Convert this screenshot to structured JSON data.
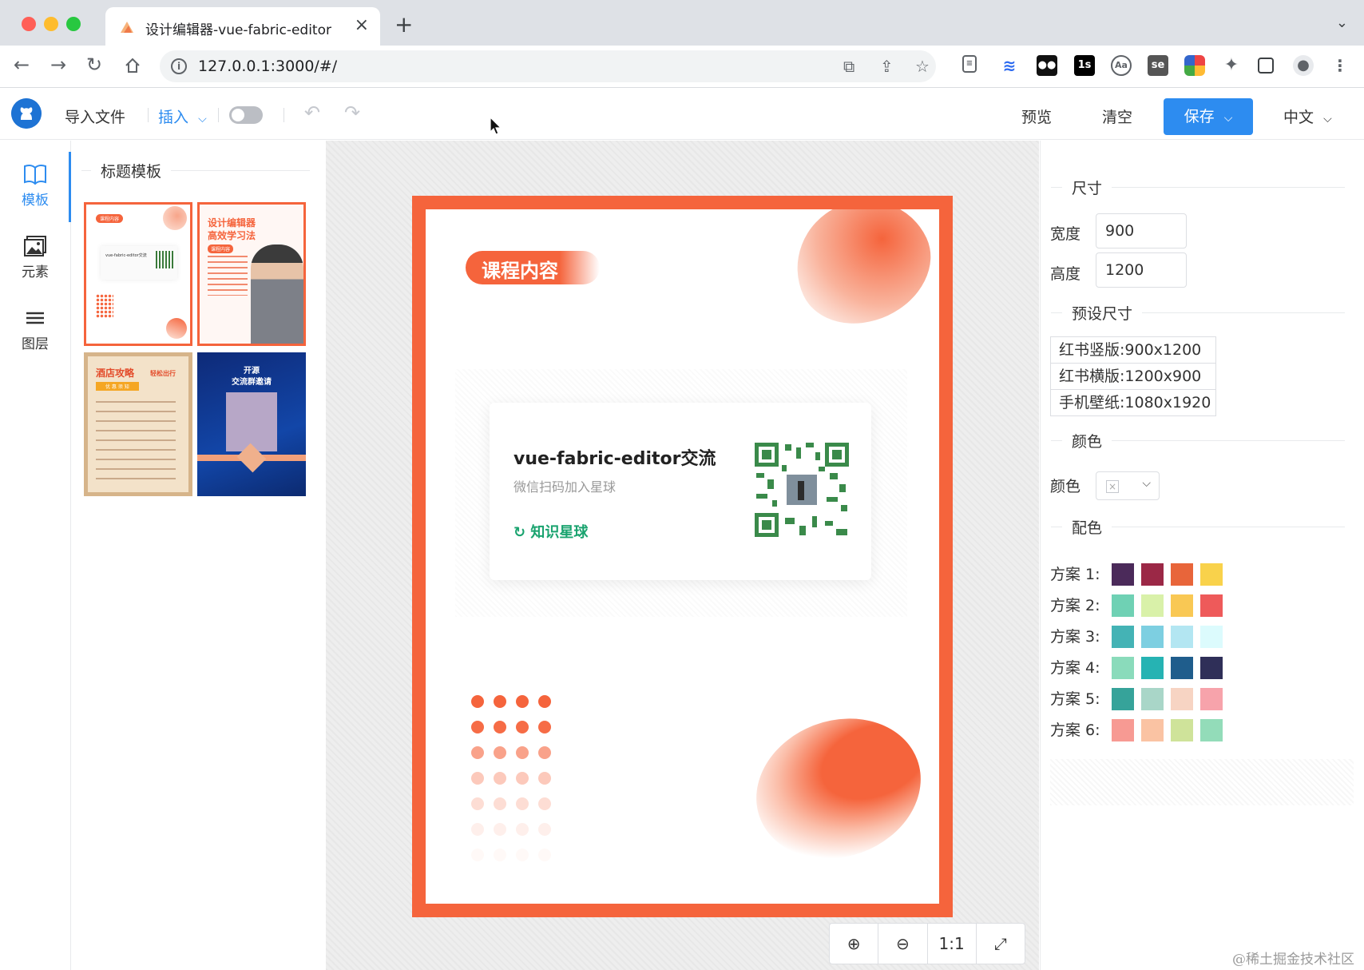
{
  "browser": {
    "tab_title": "设计编辑器-vue-fabric-editor",
    "url": "127.0.0.1:3000/#/",
    "extensions": [
      "1s",
      "se",
      "Aa"
    ]
  },
  "toolbar": {
    "import_label": "导入文件",
    "insert_label": "插入",
    "preview_label": "预览",
    "clear_label": "清空",
    "save_label": "保存",
    "language_label": "中文"
  },
  "rail": {
    "items": [
      {
        "label": "模板",
        "icon": "book-icon",
        "active": true
      },
      {
        "label": "元素",
        "icon": "image-icon",
        "active": false
      },
      {
        "label": "图层",
        "icon": "layers-icon",
        "active": false
      }
    ]
  },
  "templates": {
    "section_title": "标题模板",
    "thumb_texts": {
      "t1_tag": "课程内容",
      "t1_title": "vue-fabric-editor交流",
      "t2_title_1": "设计编辑器",
      "t2_title_2": "高效学习法",
      "t2_tag": "课程内容",
      "t3_title": "酒店攻略",
      "t3_sub": "轻松出行",
      "t3_tag": "优 惠 须 知",
      "t4_title_1": "开源",
      "t4_title_2": "交流群邀请"
    }
  },
  "poster": {
    "tag": "课程内容",
    "card_title": "vue-fabric-editor交流",
    "card_subtitle": "微信扫码加入星球",
    "brand": "知识星球",
    "accent_color": "#f5643c"
  },
  "zoom": {
    "ratio_label": "1:1"
  },
  "properties": {
    "size_title": "尺寸",
    "width_label": "宽度",
    "width_value": "900",
    "height_label": "高度",
    "height_value": "1200",
    "preset_title": "预设尺寸",
    "presets": [
      "红书竖版:900x1200",
      "红书横版:1200x900",
      "手机壁纸:1080x1920"
    ],
    "color_title": "颜色",
    "color_label": "颜色",
    "palette_title": "配色",
    "schemes": [
      {
        "label": "方案 1:",
        "colors": [
          "#4b2a5a",
          "#9b2846",
          "#e8653a",
          "#f9d24b"
        ]
      },
      {
        "label": "方案 2:",
        "colors": [
          "#6fd1b4",
          "#d9f1a9",
          "#f9c854",
          "#ee5a5a"
        ]
      },
      {
        "label": "方案 3:",
        "colors": [
          "#44b3b5",
          "#7dcfe1",
          "#b3e6f2",
          "#dcfbfd"
        ]
      },
      {
        "label": "方案 4:",
        "colors": [
          "#8adbbb",
          "#26b3b3",
          "#1f5d8c",
          "#2f2f58"
        ]
      },
      {
        "label": "方案 5:",
        "colors": [
          "#36a39a",
          "#a9d6c8",
          "#f7d4c3",
          "#f7a3ab"
        ]
      },
      {
        "label": "方案 6:",
        "colors": [
          "#f79a93",
          "#fac3a3",
          "#cfe39a",
          "#93dcb9"
        ]
      }
    ]
  },
  "watermark": "@稀土掘金技术社区"
}
